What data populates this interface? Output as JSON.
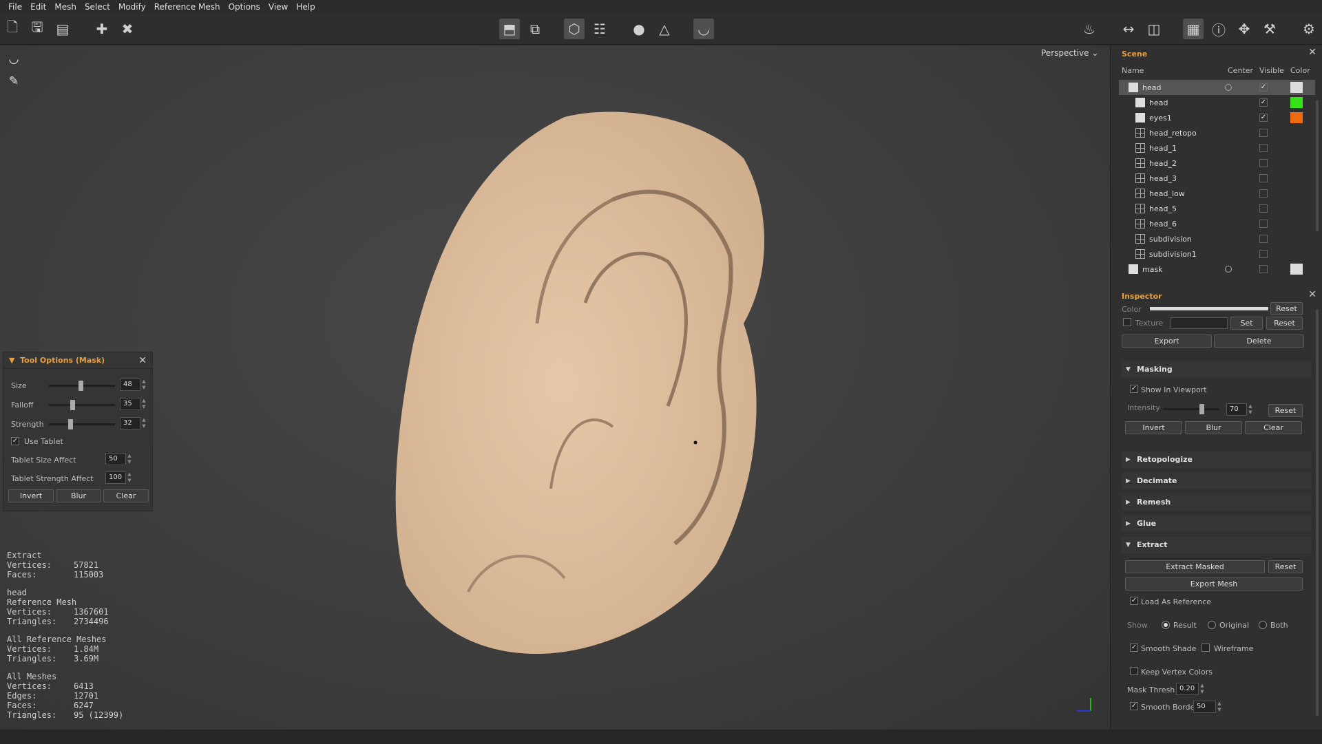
{
  "menu": [
    "File",
    "Edit",
    "Mesh",
    "Select",
    "Modify",
    "Reference Mesh",
    "Options",
    "View",
    "Help"
  ],
  "viewport": {
    "camera": "Perspective"
  },
  "tool_options": {
    "title": "Tool Options (Mask)",
    "size_label": "Size",
    "size": "48",
    "size_level": 0.48,
    "falloff_label": "Falloff",
    "falloff": "35",
    "falloff_level": 0.35,
    "strength_label": "Strength",
    "strength": "32",
    "strength_level": 0.32,
    "use_tablet": "Use Tablet",
    "tablet_size_label": "Tablet Size Affect",
    "tablet_size": "50",
    "tablet_strength_label": "Tablet Strength Affect",
    "tablet_strength": "100",
    "invert": "Invert",
    "blur": "Blur",
    "clear": "Clear"
  },
  "stats": {
    "extract": {
      "title": "Extract",
      "vertices_label": "Vertices:",
      "vertices": "57821",
      "faces_label": "Faces:",
      "faces": "115003"
    },
    "head": {
      "title": "head",
      "sub": "Reference Mesh",
      "vertices_label": "Vertices:",
      "vertices": "1367601",
      "triangles_label": "Triangles:",
      "triangles": "2734496"
    },
    "all_ref": {
      "title": "All Reference Meshes",
      "vertices_label": "Vertices:",
      "vertices": "1.84M",
      "triangles_label": "Triangles:",
      "triangles": "3.69M"
    },
    "all": {
      "title": "All Meshes",
      "vertices_label": "Vertices:",
      "vertices": "6413",
      "edges_label": "Edges:",
      "edges": "12701",
      "faces_label": "Faces:",
      "faces": "6247",
      "triangles_label": "Triangles:",
      "triangles": "95 (12399)"
    }
  },
  "scene": {
    "title": "Scene",
    "columns": {
      "name": "Name",
      "center": "Center",
      "visible": "Visible",
      "color": "Color"
    },
    "rows": [
      {
        "name": "head",
        "visible": true,
        "color": "#dcdcdc"
      },
      {
        "name": "head",
        "visible": true,
        "color": "#38e21a"
      },
      {
        "name": "eyes1",
        "visible": true,
        "color": "#f06a10"
      },
      {
        "name": "head_retopo",
        "visible": false
      },
      {
        "name": "head_1",
        "visible": false
      },
      {
        "name": "head_2",
        "visible": false
      },
      {
        "name": "head_3",
        "visible": false
      },
      {
        "name": "head_low",
        "visible": false
      },
      {
        "name": "head_5",
        "visible": false
      },
      {
        "name": "head_6",
        "visible": false
      },
      {
        "name": "subdivision",
        "visible": false
      },
      {
        "name": "subdivision1",
        "visible": false
      },
      {
        "name": "mask",
        "visible": false,
        "color": "#dcdcdc"
      }
    ]
  },
  "inspector": {
    "title": "Inspector",
    "color_label": "Color",
    "reset": "Reset",
    "texture_label": "Texture",
    "set": "Set",
    "export": "Export",
    "delete": "Delete",
    "masking": {
      "title": "Masking",
      "show_in_viewport": "Show In Viewport",
      "intensity_label": "Intensity",
      "intensity": "70",
      "intensity_level": 0.7,
      "reset": "Reset",
      "invert": "Invert",
      "blur": "Blur",
      "clear": "Clear"
    },
    "retopologize": "Retopologize",
    "decimate": "Decimate",
    "remesh": "Remesh",
    "glue": "Glue",
    "extract": {
      "title": "Extract",
      "extract_masked": "Extract Masked",
      "reset": "Reset",
      "export_mesh": "Export Mesh",
      "load_as_reference": "Load As Reference",
      "show_label": "Show",
      "result": "Result",
      "original": "Original",
      "both": "Both",
      "smooth_shade": "Smooth Shade",
      "wireframe": "Wireframe",
      "keep_vertex_colors": "Keep Vertex Colors",
      "mask_thresh_label": "Mask Thresh",
      "mask_thresh": "0.20",
      "smooth_border_label": "Smooth Border",
      "smooth_border": "50"
    }
  }
}
